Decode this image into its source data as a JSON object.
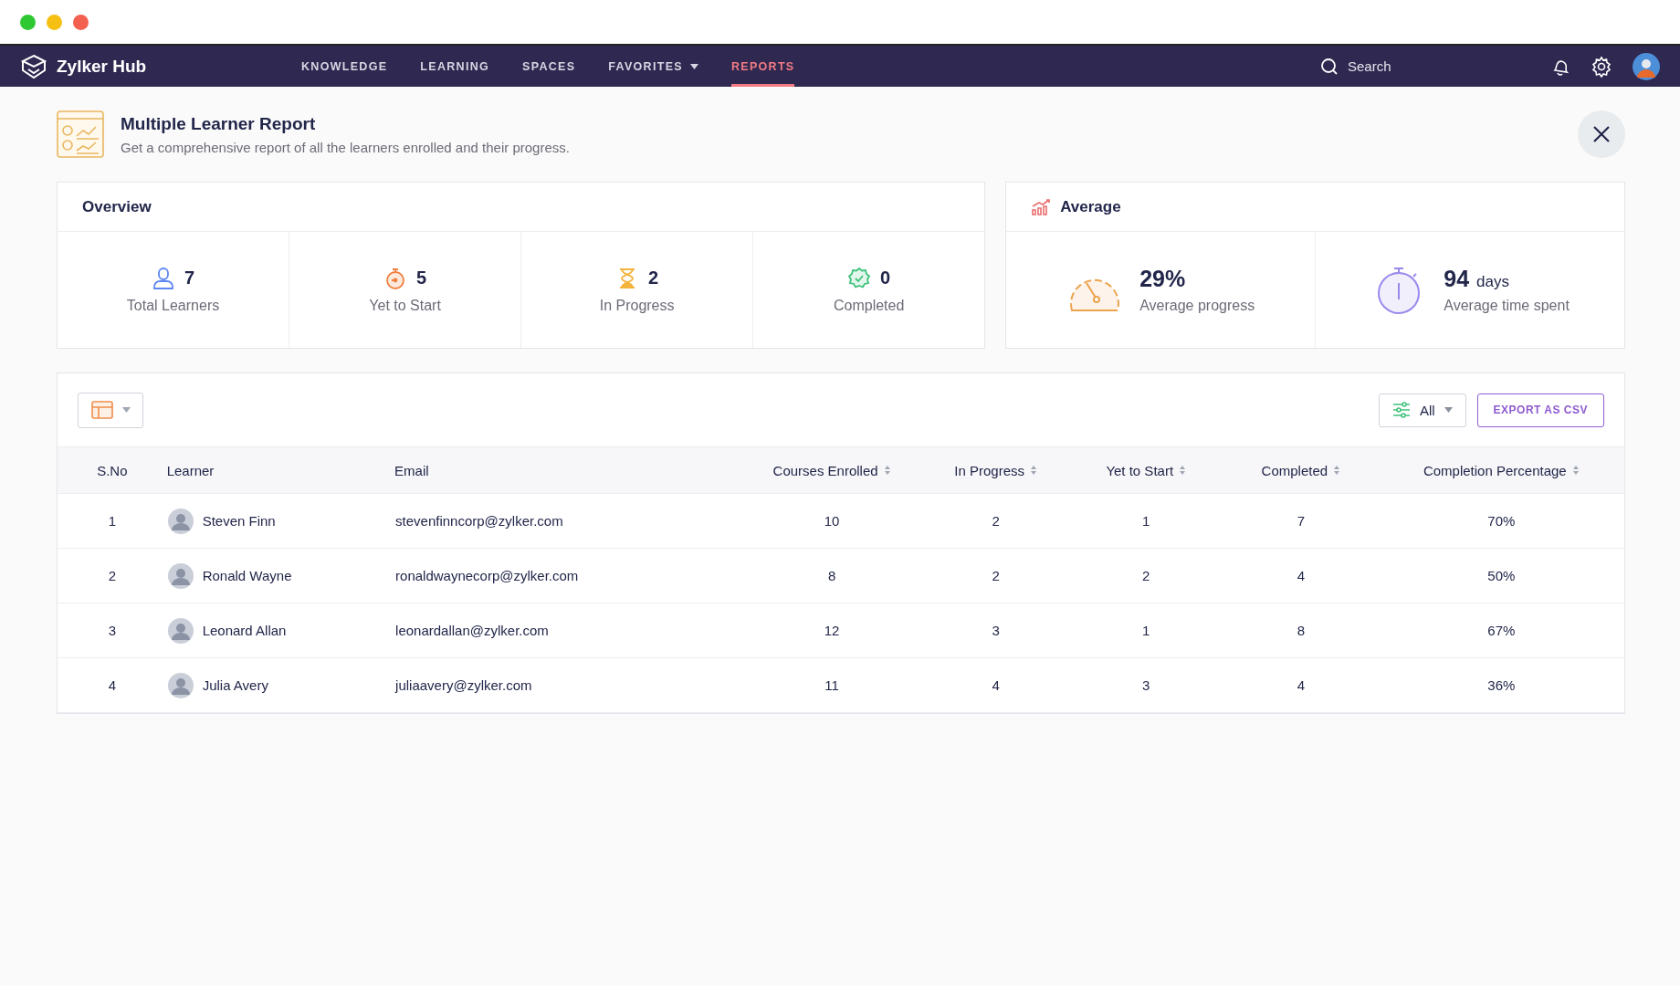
{
  "app": {
    "name": "Zylker Hub"
  },
  "nav": [
    {
      "label": "KNOWLEDGE",
      "selected": false,
      "dropdown": false
    },
    {
      "label": "LEARNING",
      "selected": false,
      "dropdown": false
    },
    {
      "label": "SPACES",
      "selected": false,
      "dropdown": false
    },
    {
      "label": "FAVORITES",
      "selected": false,
      "dropdown": true
    },
    {
      "label": "REPORTS",
      "selected": true,
      "dropdown": false
    }
  ],
  "search": {
    "placeholder": "Search"
  },
  "report": {
    "title": "Multiple Learner Report",
    "subtitle": "Get a comprehensive report of all the learners enrolled and their progress."
  },
  "overview": {
    "title": "Overview",
    "stats": [
      {
        "kind": "person",
        "value": "7",
        "label": "Total Learners"
      },
      {
        "kind": "timer",
        "value": "5",
        "label": "Yet to Start"
      },
      {
        "kind": "hourglass",
        "value": "2",
        "label": "In Progress"
      },
      {
        "kind": "badge",
        "value": "0",
        "label": "Completed"
      }
    ]
  },
  "average": {
    "title": "Average",
    "stats": [
      {
        "kind": "gauge",
        "value": "29%",
        "label": "Average progress"
      },
      {
        "kind": "stopwatch",
        "value": "94",
        "unit": "days",
        "label": "Average time spent"
      }
    ]
  },
  "toolbar": {
    "filter": "All",
    "export": "EXPORT AS CSV"
  },
  "table": {
    "columns": [
      {
        "label": "S.No",
        "sortable": false
      },
      {
        "label": "Learner",
        "sortable": false
      },
      {
        "label": "Email",
        "sortable": false
      },
      {
        "label": "Courses Enrolled",
        "sortable": true
      },
      {
        "label": "In Progress",
        "sortable": true
      },
      {
        "label": "Yet to Start",
        "sortable": true
      },
      {
        "label": "Completed",
        "sortable": true
      },
      {
        "label": "Completion Percentage",
        "sortable": true
      }
    ],
    "rows": [
      {
        "sno": "1",
        "name": "Steven Finn",
        "email": "stevenfinncorp@zylker.com",
        "enrolled": "10",
        "in_progress": "2",
        "yet_to_start": "1",
        "completed": "7",
        "percentage": "70%"
      },
      {
        "sno": "2",
        "name": "Ronald Wayne",
        "email": "ronaldwaynecorp@zylker.com",
        "enrolled": "8",
        "in_progress": "2",
        "yet_to_start": "2",
        "completed": "4",
        "percentage": "50%"
      },
      {
        "sno": "3",
        "name": "Leonard Allan",
        "email": "leonardallan@zylker.com",
        "enrolled": "12",
        "in_progress": "3",
        "yet_to_start": "1",
        "completed": "8",
        "percentage": "67%"
      },
      {
        "sno": "4",
        "name": "Julia Avery",
        "email": "juliaavery@zylker.com",
        "enrolled": "11",
        "in_progress": "4",
        "yet_to_start": "3",
        "completed": "4",
        "percentage": "36%"
      }
    ]
  }
}
